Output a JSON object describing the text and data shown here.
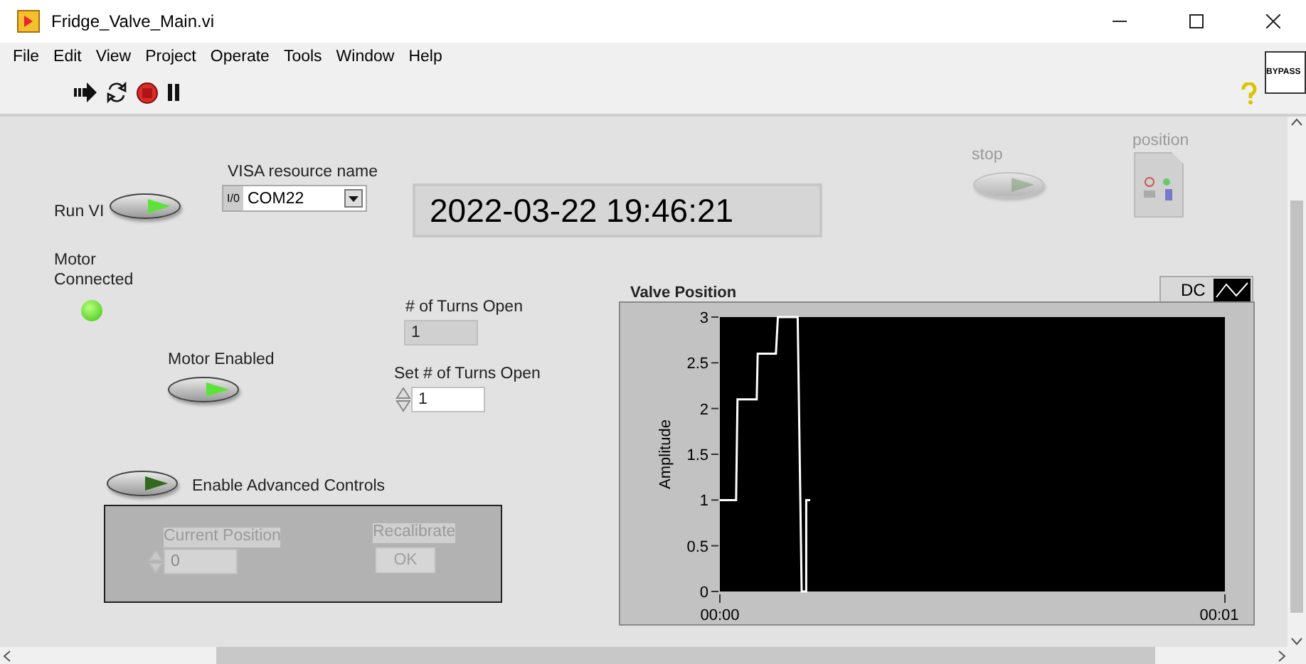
{
  "window": {
    "title": "Fridge_Valve_Main.vi"
  },
  "menu": [
    "File",
    "Edit",
    "View",
    "Project",
    "Operate",
    "Tools",
    "Window",
    "Help"
  ],
  "bypass": "BYPASS",
  "run_vi": {
    "label": "Run VI",
    "on": true,
    "disabled": false
  },
  "visa": {
    "label": "VISA resource name",
    "value": "COM22",
    "prefix": "I/0"
  },
  "timestamp": "2022-03-22 19:46:21",
  "motor_connected": {
    "label": "Motor\nConnected",
    "on": true
  },
  "turns_open": {
    "label": "# of Turns Open",
    "value": "1"
  },
  "motor_enabled": {
    "label": "Motor Enabled",
    "on": true,
    "disabled": false
  },
  "set_turns": {
    "label": "Set # of Turns Open",
    "value": "1"
  },
  "advanced": {
    "label": "Enable Advanced Controls",
    "on": false,
    "disabled": false
  },
  "advanced_panel": {
    "disabled": true,
    "current_position": {
      "label": "Current Position",
      "value": "0"
    },
    "recalibrate": {
      "label": "Recalibrate",
      "button": "OK"
    }
  },
  "stop": {
    "label": "stop",
    "on": false,
    "disabled": true
  },
  "position": {
    "label": "position"
  },
  "chart": {
    "title": "Valve Position",
    "mode_button": "DC",
    "chart_data": {
      "type": "line",
      "ylabel": "Amplitude",
      "xlim": [
        0,
        1
      ],
      "ylim": [
        0,
        3
      ],
      "yticks": [
        0,
        0.5,
        1,
        1.5,
        2,
        2.5,
        3
      ],
      "xticks": [
        {
          "value": 0,
          "label": "00:00"
        },
        {
          "value": 1,
          "label": "00:01"
        }
      ],
      "x": [
        0,
        0.032,
        0.035,
        0.073,
        0.075,
        0.111,
        0.115,
        0.154,
        0.162,
        0.171,
        0.171,
        0.179
      ],
      "series": [
        {
          "color": "#ffffff",
          "values": [
            1,
            1,
            2.1,
            2.1,
            2.6,
            2.6,
            3,
            3,
            0,
            0,
            1,
            1
          ]
        }
      ]
    }
  }
}
